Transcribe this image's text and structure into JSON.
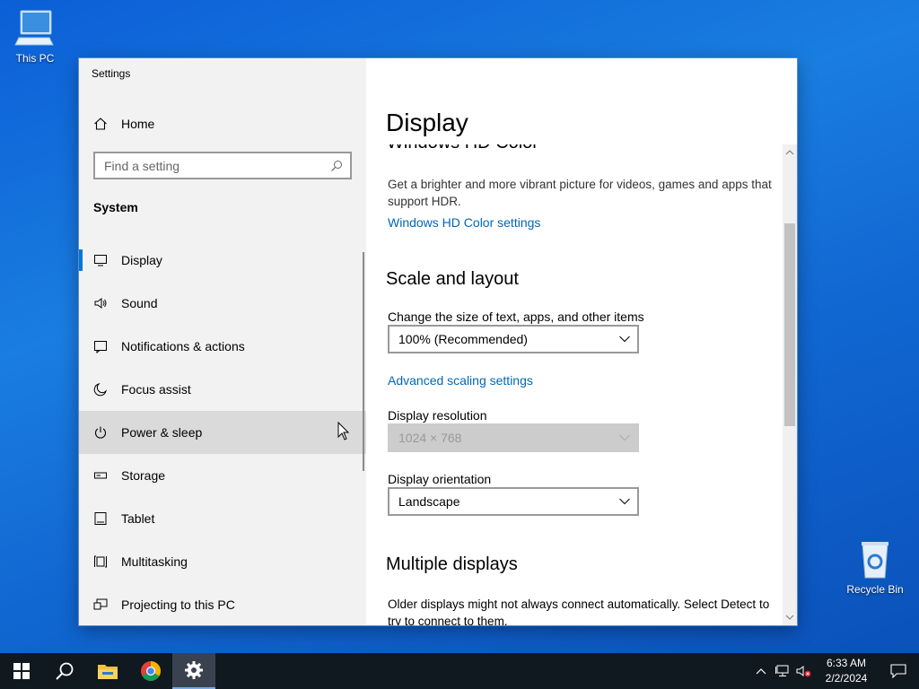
{
  "desktop": {
    "this_pc_label": "This PC",
    "recycle_bin_label": "Recycle Bin"
  },
  "window": {
    "app_title": "Settings",
    "home_label": "Home",
    "search_placeholder": "Find a setting",
    "section_label": "System",
    "nav_items": [
      {
        "label": "Display",
        "icon": "monitor-icon",
        "selected": true
      },
      {
        "label": "Sound",
        "icon": "speaker-icon"
      },
      {
        "label": "Notifications & actions",
        "icon": "notification-icon"
      },
      {
        "label": "Focus assist",
        "icon": "moon-icon"
      },
      {
        "label": "Power & sleep",
        "icon": "power-icon",
        "hovered": true
      },
      {
        "label": "Storage",
        "icon": "storage-icon"
      },
      {
        "label": "Tablet",
        "icon": "tablet-icon"
      },
      {
        "label": "Multitasking",
        "icon": "multitasking-icon"
      },
      {
        "label": "Projecting to this PC",
        "icon": "projecting-icon"
      }
    ]
  },
  "content": {
    "page_title": "Display",
    "hdr_heading": "Windows HD Color",
    "hdr_description": "Get a brighter and more vibrant picture for videos, games and apps that support HDR.",
    "hdr_link": "Windows HD Color settings",
    "scale_heading": "Scale and layout",
    "scale_label": "Change the size of text, apps, and other items",
    "scale_value": "100% (Recommended)",
    "advanced_scaling_link": "Advanced scaling settings",
    "resolution_label": "Display resolution",
    "resolution_value": "1024 × 768",
    "orientation_label": "Display orientation",
    "orientation_value": "Landscape",
    "multiple_heading": "Multiple displays",
    "multiple_description": "Older displays might not always connect automatically. Select Detect to try to connect to them."
  },
  "taskbar": {
    "time": "6:33 AM",
    "date": "2/2/2024"
  },
  "colors": {
    "accent": "#0078d7",
    "link": "#0067b8",
    "taskbar": "#101820"
  }
}
